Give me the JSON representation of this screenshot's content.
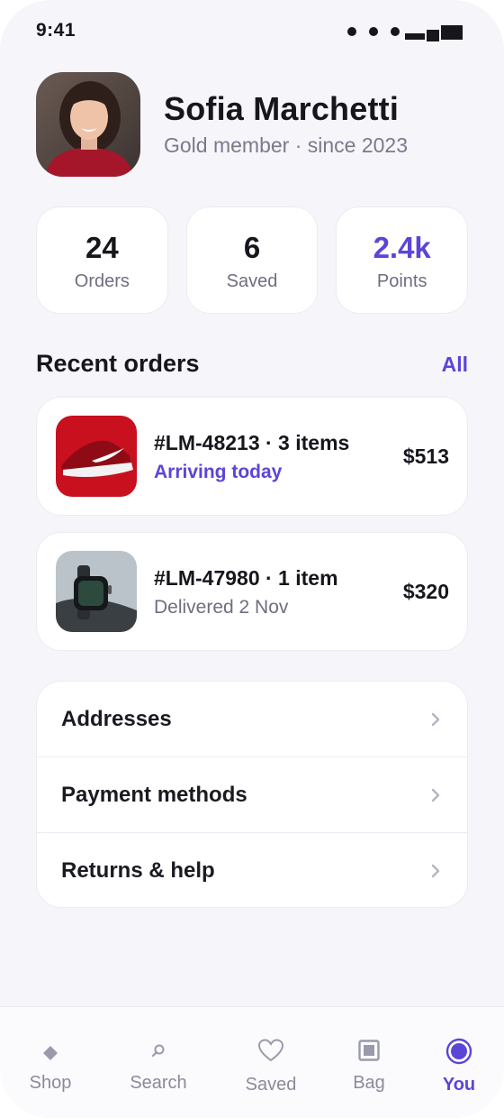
{
  "status_bar": {
    "time": "9:41"
  },
  "profile": {
    "name": "Sofia Marchetti",
    "subtitle": "Gold member · since 2023"
  },
  "stats": [
    {
      "value": "24",
      "label": "Orders"
    },
    {
      "value": "6",
      "label": "Saved"
    },
    {
      "value": "2.4k",
      "label": "Points"
    }
  ],
  "recent_orders": {
    "title": "Recent orders",
    "all_label": "All",
    "items": [
      {
        "title": "#LM-48213 · 3 items",
        "status": "Arriving today",
        "price": "$513",
        "thumb": "red-sneaker-image"
      },
      {
        "title": "#LM-47980 · 1 item",
        "status": "Delivered 2 Nov",
        "price": "$320",
        "thumb": "smartwatch-image"
      }
    ]
  },
  "menu": [
    {
      "label": "Addresses"
    },
    {
      "label": "Payment methods"
    },
    {
      "label": "Returns & help"
    }
  ],
  "tabbar": [
    {
      "label": "Shop",
      "icon": "diamond-icon"
    },
    {
      "label": "Search",
      "icon": "search-icon"
    },
    {
      "label": "Saved",
      "icon": "heart-icon"
    },
    {
      "label": "Bag",
      "icon": "bag-icon"
    },
    {
      "label": "You",
      "icon": "profile-icon",
      "active": true
    }
  ],
  "colors": {
    "accent": "#5b45d6",
    "background": "#f6f5fa",
    "muted": "#7a7a8c"
  }
}
